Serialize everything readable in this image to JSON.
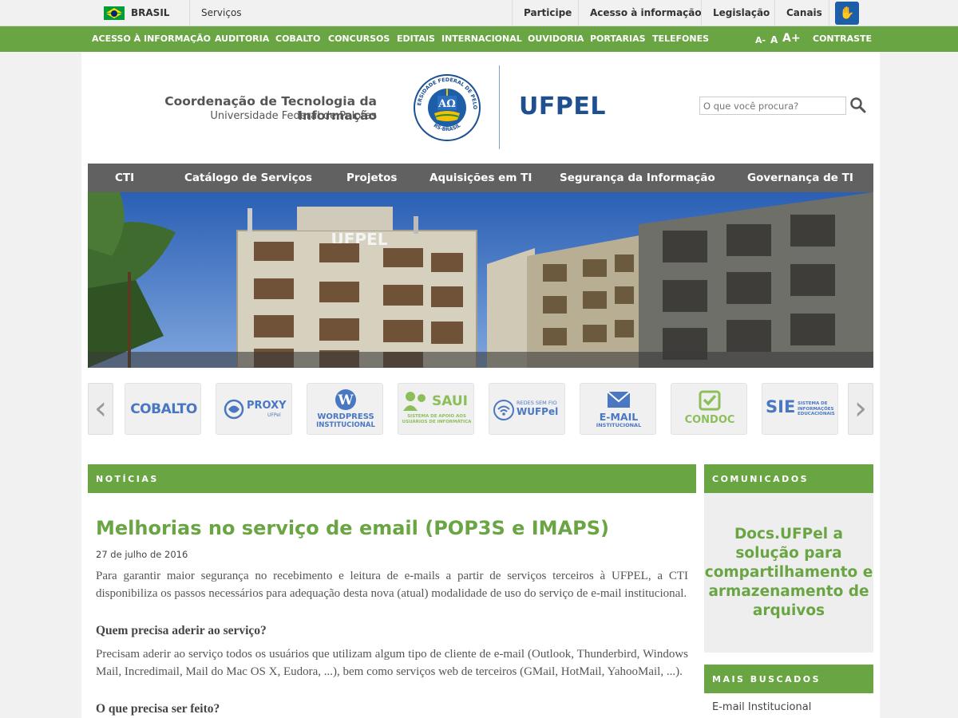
{
  "govbar": {
    "country": "BRASIL",
    "services": "Serviços",
    "links": [
      "Participe",
      "Acesso à informação",
      "Legislação",
      "Canais"
    ]
  },
  "topnav": {
    "items": [
      "ACESSO À INFORMAÇÃO",
      "AUDITORIA",
      "COBALTO",
      "CONCURSOS",
      "EDITAIS",
      "INTERNACIONAL",
      "OUVIDORIA",
      "PORTARIAS",
      "TELEFONES"
    ],
    "font_small": "A-",
    "font_normal": "A",
    "font_large": "A+",
    "contrast": "CONTRASTE"
  },
  "header": {
    "title": "Coordenação de Tecnologia da Informação",
    "subtitle": "Universidade Federal de Pelotas",
    "seal_text_top": "UNIVERSIDADE FEDERAL DE PELOTAS",
    "seal_text_bottom": "RS-BRASIL",
    "brand": "UFPEL",
    "search_placeholder": "O que você procura?"
  },
  "mainmenu": {
    "items": [
      "CTI",
      "Catálogo de Serviços",
      "Projetos",
      "Aquisições em TI",
      "Segurança da Informação",
      "Governança de TI"
    ]
  },
  "hero": {
    "building_sign": "UFPEL"
  },
  "carousel": {
    "prev": "‹",
    "next": "›",
    "tiles": [
      {
        "label": "COBALTO"
      },
      {
        "label": "PROXY",
        "sub": "UFPel"
      },
      {
        "label": "WORDPRESS",
        "sub": "INSTITUCIONAL"
      },
      {
        "label": "SAUI",
        "sub": "SISTEMA DE APOIO AOS USUÁRIOS DE INFORMÁTICA"
      },
      {
        "label": "WUFPel",
        "sub": "REDES SEM FIO"
      },
      {
        "label": "E-MAIL",
        "sub": "INSTITUCIONAL"
      },
      {
        "label": "CONDOC"
      },
      {
        "label": "SIE",
        "sub": "SISTEMA DE INFORMAÇÕES EDUCACIONAIS"
      }
    ]
  },
  "news": {
    "section": "NOTÍCIAS",
    "title": "Melhorias no serviço de email (POP3S e IMAPS)",
    "date": "27 de julho de 2016",
    "p1": "Para garantir maior segurança no recebimento e leitura de e-mails a partir de serviços terceiros à UFPEL, a CTI disponibiliza os passos necessários para adequação desta nova (atual) modalidade de uso do serviço de e-mail institucional.",
    "q1": "Quem precisa aderir ao serviço?",
    "p2": "Precisam aderir ao serviço todos os usuários que utilizam algum tipo de cliente de e-mail (Outlook, Thunderbird, Windows Mail, Incredimail, Mail do Mac OS X, Eudora, ...), bem como serviços web de terceiros (GMail, HotMail, YahooMail, ...).",
    "q2": "O que precisa ser feito?"
  },
  "sidebar": {
    "comunicados": "COMUNICADOS",
    "comunicado_text": "Docs.UFPel a solução para compartilhamento e armazenamento de arquivos",
    "mais_buscados": "MAIS BUSCADOS",
    "mais_buscados_items": [
      "E-mail Institucional"
    ]
  },
  "colors": {
    "green": "#6aa543",
    "dark_menu": "#616161",
    "ufpel_blue": "#1d4f91"
  }
}
